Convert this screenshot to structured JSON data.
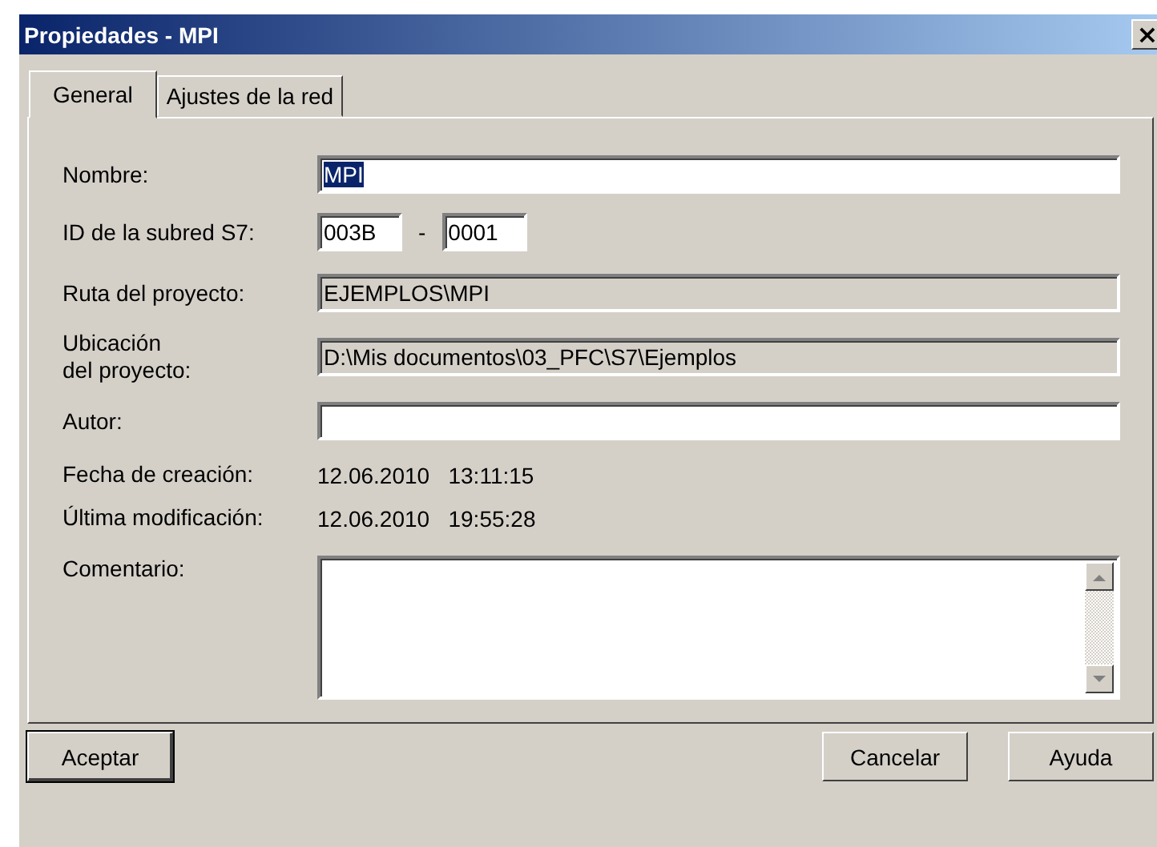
{
  "window": {
    "title": "Propiedades - MPI",
    "close": "×"
  },
  "tabs": [
    {
      "label": "General",
      "selected": true
    },
    {
      "label": "Ajustes de la red",
      "selected": false
    }
  ],
  "fields": [
    {
      "kind": "text",
      "label": "Nombre:",
      "value": "MPI",
      "text_selected": true
    },
    {
      "kind": "pair",
      "label": "ID de la subred S7:",
      "values": [
        "003B",
        "0001"
      ],
      "separator": "-"
    },
    {
      "kind": "readonly",
      "label": "Ruta del proyecto:",
      "value": "EJEMPLOS\\MPI"
    },
    {
      "kind": "readonly",
      "label": "Ubicación\ndel proyecto:",
      "value": "D:\\Mis documentos\\03_PFC\\S7\\Ejemplos"
    },
    {
      "kind": "text",
      "label": "Autor:"
    },
    {
      "kind": "info",
      "label": "Fecha de creación:",
      "value": "12.06.2010   13:11:15"
    },
    {
      "kind": "info",
      "label": "Última modificación:",
      "value": "12.06.2010   19:55:28"
    },
    {
      "kind": "textarea",
      "label": "Comentario:"
    }
  ],
  "buttons": [
    {
      "label": "Aceptar",
      "default": true
    },
    {
      "label": "Cancelar",
      "default": false
    },
    {
      "label": "Ayuda",
      "default": false
    }
  ]
}
